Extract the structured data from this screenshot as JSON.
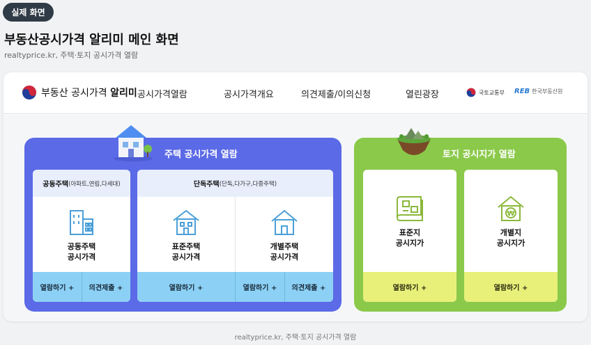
{
  "badge": "실제 화면",
  "page": {
    "title": "부동산공시가격 알리미 메인 화면",
    "subtitle": "realtyprice.kr, 주택·토지 공시가격 열람"
  },
  "site": {
    "logo_prefix": "부동산 공시가격",
    "logo_strong": "알리미",
    "gov_name": "국토교통부",
    "reb_mark": "REB",
    "reb_name": "한국부동산원"
  },
  "nav": [
    "공시가격열람",
    "공시가격개요",
    "의견제출/이의신청",
    "열린광장"
  ],
  "house": {
    "title": "주택 공시가격 열람",
    "apartment": {
      "head_strong": "공동주택",
      "head_detail": "(아파트,연립,다세대)",
      "label_line1": "공동주택",
      "label_line2": "공시가격",
      "view_btn": "열람하기 +",
      "opinion_btn": "의견제출 +"
    },
    "detached": {
      "head_strong": "단독주택",
      "head_detail": "(단독,다가구,다중주택)",
      "standard_line1": "표준주택",
      "standard_line2": "공시가격",
      "individual_line1": "개별주택",
      "individual_line2": "공시가격",
      "standard_view_btn": "열람하기 +",
      "individual_view_btn": "열람하기 +",
      "individual_opinion_btn": "의견제출 +"
    }
  },
  "land": {
    "title": "토지 공시지가 열람",
    "standard_line1": "표준지",
    "standard_line2": "공시지가",
    "individual_line1": "개별지",
    "individual_line2": "공시지가",
    "standard_view_btn": "열람하기 +",
    "individual_view_btn": "열람하기 +",
    "won_symbol": "₩"
  },
  "footer": "realtyprice.kr, 주택·토지 공시가격 열람",
  "colors": {
    "house_panel": "#5b6ae6",
    "land_panel": "#8bc94a",
    "house_button": "#8cd1f5",
    "land_button": "#e8f07a",
    "icon_blue": "#4a9fd8",
    "icon_green": "#8ab83a"
  }
}
